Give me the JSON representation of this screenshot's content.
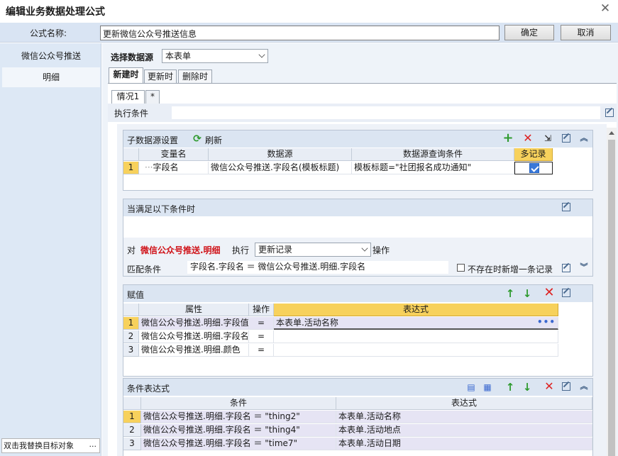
{
  "window": {
    "title": "编辑业务数据处理公式"
  },
  "formula": {
    "name_label": "公式名称:",
    "name_value": "更新微信公众号推送信息",
    "ok_label": "确定",
    "cancel_label": "取消"
  },
  "sidebar": {
    "items": [
      {
        "label": "微信公众号推送"
      },
      {
        "label": "明细"
      }
    ],
    "hint": "双击我替换目标对象",
    "hint_more": "..."
  },
  "datasource": {
    "label": "选择数据源",
    "value": "本表单"
  },
  "tabs": [
    {
      "label": "新建时"
    },
    {
      "label": "更新时"
    },
    {
      "label": "删除时"
    }
  ],
  "subtabs": [
    {
      "label": "情况1"
    },
    {
      "label": "*"
    }
  ],
  "exec_condition": {
    "label": "执行条件",
    "value": ""
  },
  "subsource": {
    "title": "子数据源设置",
    "refresh_label": "刷新",
    "columns": [
      "变量名",
      "数据源",
      "数据源查询条件",
      "多记录"
    ],
    "rows": [
      {
        "num": "1",
        "var": "字段名",
        "source": "微信公众号推送.字段名(模板标题)",
        "query": "模板标题=\"社团报名成功通知\"",
        "multi": true
      }
    ]
  },
  "when": {
    "title": "当满足以下条件时",
    "target_prefix": "对",
    "target": "微信公众号推送.明细",
    "exec_label": "执行",
    "action": "更新记录",
    "op_label": "操作",
    "match_label": "匹配条件",
    "match_value": "字段名.字段名 ＝ 微信公众号推送.明细.字段名",
    "insert_label": "不存在时新增一条记录"
  },
  "assign": {
    "title": "赋值",
    "columns": [
      "属性",
      "操作",
      "表达式"
    ],
    "rows": [
      {
        "num": "1",
        "attr": "微信公众号推送.明细.字段值",
        "op": "=",
        "expr": "本表单.活动名称"
      },
      {
        "num": "2",
        "attr": "微信公众号推送.明细.字段名",
        "op": "=",
        "expr": ""
      },
      {
        "num": "3",
        "attr": "微信公众号推送.明细.颜色",
        "op": "=",
        "expr": ""
      }
    ],
    "more": "•••"
  },
  "condexpr": {
    "title": "条件表达式",
    "columns": [
      "条件",
      "表达式"
    ],
    "rows": [
      {
        "num": "1",
        "cond": "微信公众号推送.明细.字段名 ＝ \"thing2\"",
        "expr": "本表单.活动名称"
      },
      {
        "num": "2",
        "cond": "微信公众号推送.明细.字段名 ＝ \"thing4\"",
        "expr": "本表单.活动地点"
      },
      {
        "num": "3",
        "cond": "微信公众号推送.明细.字段名 ＝  \"time7\"",
        "expr": "本表单.活动日期"
      }
    ]
  },
  "icons": {
    "close": "close-icon",
    "add": "plus-icon",
    "delete": "delete-icon",
    "edit": "edit-icon",
    "refresh": "refresh-icon",
    "up": "arrow-up-icon",
    "down": "arrow-down-icon",
    "collapse": "chevron-up-icon"
  },
  "colors": {
    "accent": "#d0141a",
    "header_bg": "#dbe5f2",
    "highlight": "#f7d15c",
    "check": "#3a78d8"
  }
}
